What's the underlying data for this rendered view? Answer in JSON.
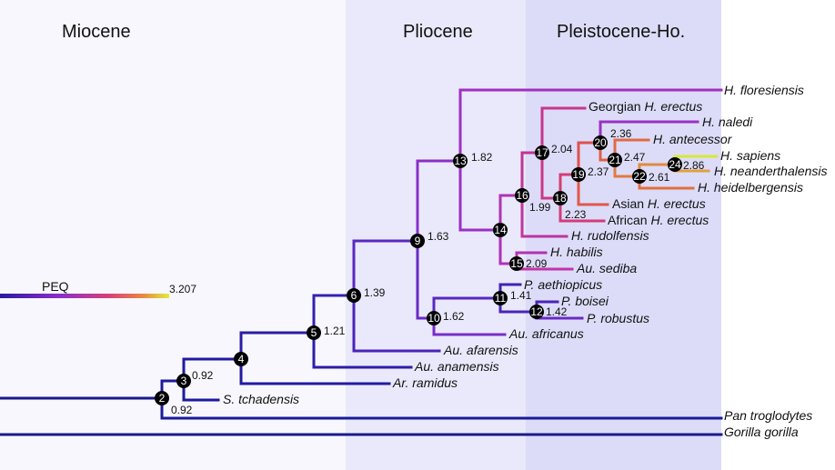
{
  "eras": [
    {
      "label": "Miocene",
      "color": "#f7f7fd"
    },
    {
      "label": "Pliocene",
      "color": "#e6e6fb"
    },
    {
      "label": "Pleistocene-Ho.",
      "color": "#d9d9f8"
    }
  ],
  "legend": {
    "label": "PEQ",
    "max_label": "3.207"
  },
  "colors": {
    "low": "#1a1a9a",
    "mid": "#9933cc",
    "high": "#dd4466",
    "top": "#e08840",
    "peak": "#d8e838",
    "node": "#000000"
  },
  "nodes": [
    {
      "num": "2",
      "value": "0.92"
    },
    {
      "num": "3",
      "value": "0.92"
    },
    {
      "num": "4",
      "value": ""
    },
    {
      "num": "5",
      "value": "1.21"
    },
    {
      "num": "6",
      "value": "1.39"
    },
    {
      "num": "9",
      "value": "1.63"
    },
    {
      "num": "10",
      "value": "1.62"
    },
    {
      "num": "11",
      "value": "1.41"
    },
    {
      "num": "12",
      "value": "1.42"
    },
    {
      "num": "13",
      "value": "1.82"
    },
    {
      "num": "14",
      "value": ""
    },
    {
      "num": "15",
      "value": "2.09"
    },
    {
      "num": "16",
      "value": "1.99"
    },
    {
      "num": "17",
      "value": "2.04"
    },
    {
      "num": "18",
      "value": "2.23"
    },
    {
      "num": "19",
      "value": "2.37"
    },
    {
      "num": "20",
      "value": "2.36"
    },
    {
      "num": "21",
      "value": "2.47"
    },
    {
      "num": "22",
      "value": "2.61"
    },
    {
      "num": "24",
      "value": "2.86"
    }
  ],
  "taxa": [
    {
      "pre": "",
      "it": "H. floresiensis"
    },
    {
      "pre": "Georgian ",
      "it": "H. erectus"
    },
    {
      "pre": "",
      "it": "H. naledi"
    },
    {
      "pre": "",
      "it": "H. antecessor"
    },
    {
      "pre": "",
      "it": "H. sapiens"
    },
    {
      "pre": "",
      "it": "H. neanderthalensis"
    },
    {
      "pre": "",
      "it": "H. heidelbergensis"
    },
    {
      "pre": "Asian ",
      "it": "H. erectus"
    },
    {
      "pre": "African ",
      "it": "H. erectus"
    },
    {
      "pre": "",
      "it": "H. rudolfensis"
    },
    {
      "pre": "",
      "it": "H. habilis"
    },
    {
      "pre": "",
      "it": "Au. sediba"
    },
    {
      "pre": "",
      "it": "P. aethiopicus"
    },
    {
      "pre": "",
      "it": "P. boisei"
    },
    {
      "pre": "",
      "it": "P. robustus"
    },
    {
      "pre": "",
      "it": "Au. africanus"
    },
    {
      "pre": "",
      "it": "Au. afarensis"
    },
    {
      "pre": "",
      "it": "Au. anamensis"
    },
    {
      "pre": "",
      "it": "Ar. ramidus"
    },
    {
      "pre": "",
      "it": "S. tchadensis"
    },
    {
      "pre": "",
      "it": "Pan troglodytes"
    },
    {
      "pre": "",
      "it": "Gorilla gorilla"
    }
  ]
}
